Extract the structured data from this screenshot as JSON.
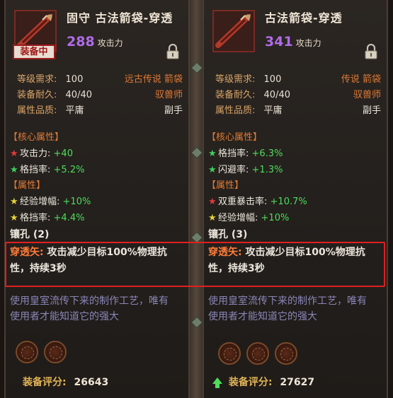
{
  "left": {
    "title": "固守 古法箭袋-穿透",
    "attack_value": "288",
    "attack_label": "攻击力",
    "equipped_label": "装备中",
    "level_req_label": "等级需求:",
    "level_req_value": "100",
    "rarity": "远古传说 箭袋",
    "durability_label": "装备耐久:",
    "durability_value": "40/40",
    "class": "驭兽师",
    "quality_label": "属性品质:",
    "quality_value": "平庸",
    "slot": "副手",
    "core_header": "【核心属性】",
    "core_stats": [
      {
        "star": "red",
        "label": "攻击力:",
        "value": "+40"
      },
      {
        "star": "green",
        "label": "格挡率:",
        "value": "+5.2%"
      }
    ],
    "attr_header": "【属性】",
    "attr_stats": [
      {
        "star": "yellow",
        "label": "经验增幅:",
        "value": "+10%"
      },
      {
        "star": "yellow",
        "label": "格挡率:",
        "value": "+4.4%"
      }
    ],
    "socket_label": "镶孔 (2)",
    "effect_name": "穿透矢:",
    "effect_text": "攻击减少目标100%物理抗性，持续3秒",
    "lore": "使用皇室流传下来的制作工艺，唯有使用者才能知道它的强大",
    "sockets": 2,
    "score_label": "装备评分:",
    "score_value": "26643"
  },
  "right": {
    "title": "古法箭袋-穿透",
    "attack_value": "341",
    "attack_label": "攻击力",
    "level_req_label": "等级需求:",
    "level_req_value": "100",
    "rarity": "传说 箭袋",
    "durability_label": "装备耐久:",
    "durability_value": "40/40",
    "class": "驭兽师",
    "quality_label": "属性品质:",
    "quality_value": "平庸",
    "slot": "副手",
    "core_header": "【核心属性】",
    "core_stats": [
      {
        "star": "green",
        "label": "格挡率:",
        "value": "+6.3%"
      },
      {
        "star": "green",
        "label": "闪避率:",
        "value": "+1.3%"
      }
    ],
    "attr_header": "【属性】",
    "attr_stats": [
      {
        "star": "red",
        "label": "双重暴击率:",
        "value": "+10.7%"
      },
      {
        "star": "yellow",
        "label": "经验增幅:",
        "value": "+10%"
      }
    ],
    "socket_label": "镶孔 (3)",
    "effect_name": "穿透矢:",
    "effect_text": "攻击减少目标100%物理抗性，持续3秒",
    "lore": "使用皇室流传下来的制作工艺，唯有使用者才能知道它的强大",
    "sockets": 3,
    "score_label": "装备评分:",
    "score_value": "27627"
  },
  "colors": {
    "highlight": "#e02020",
    "attack": "#b06ce8",
    "effect_name": "#ff7d3a",
    "lore": "#8a86b8"
  }
}
